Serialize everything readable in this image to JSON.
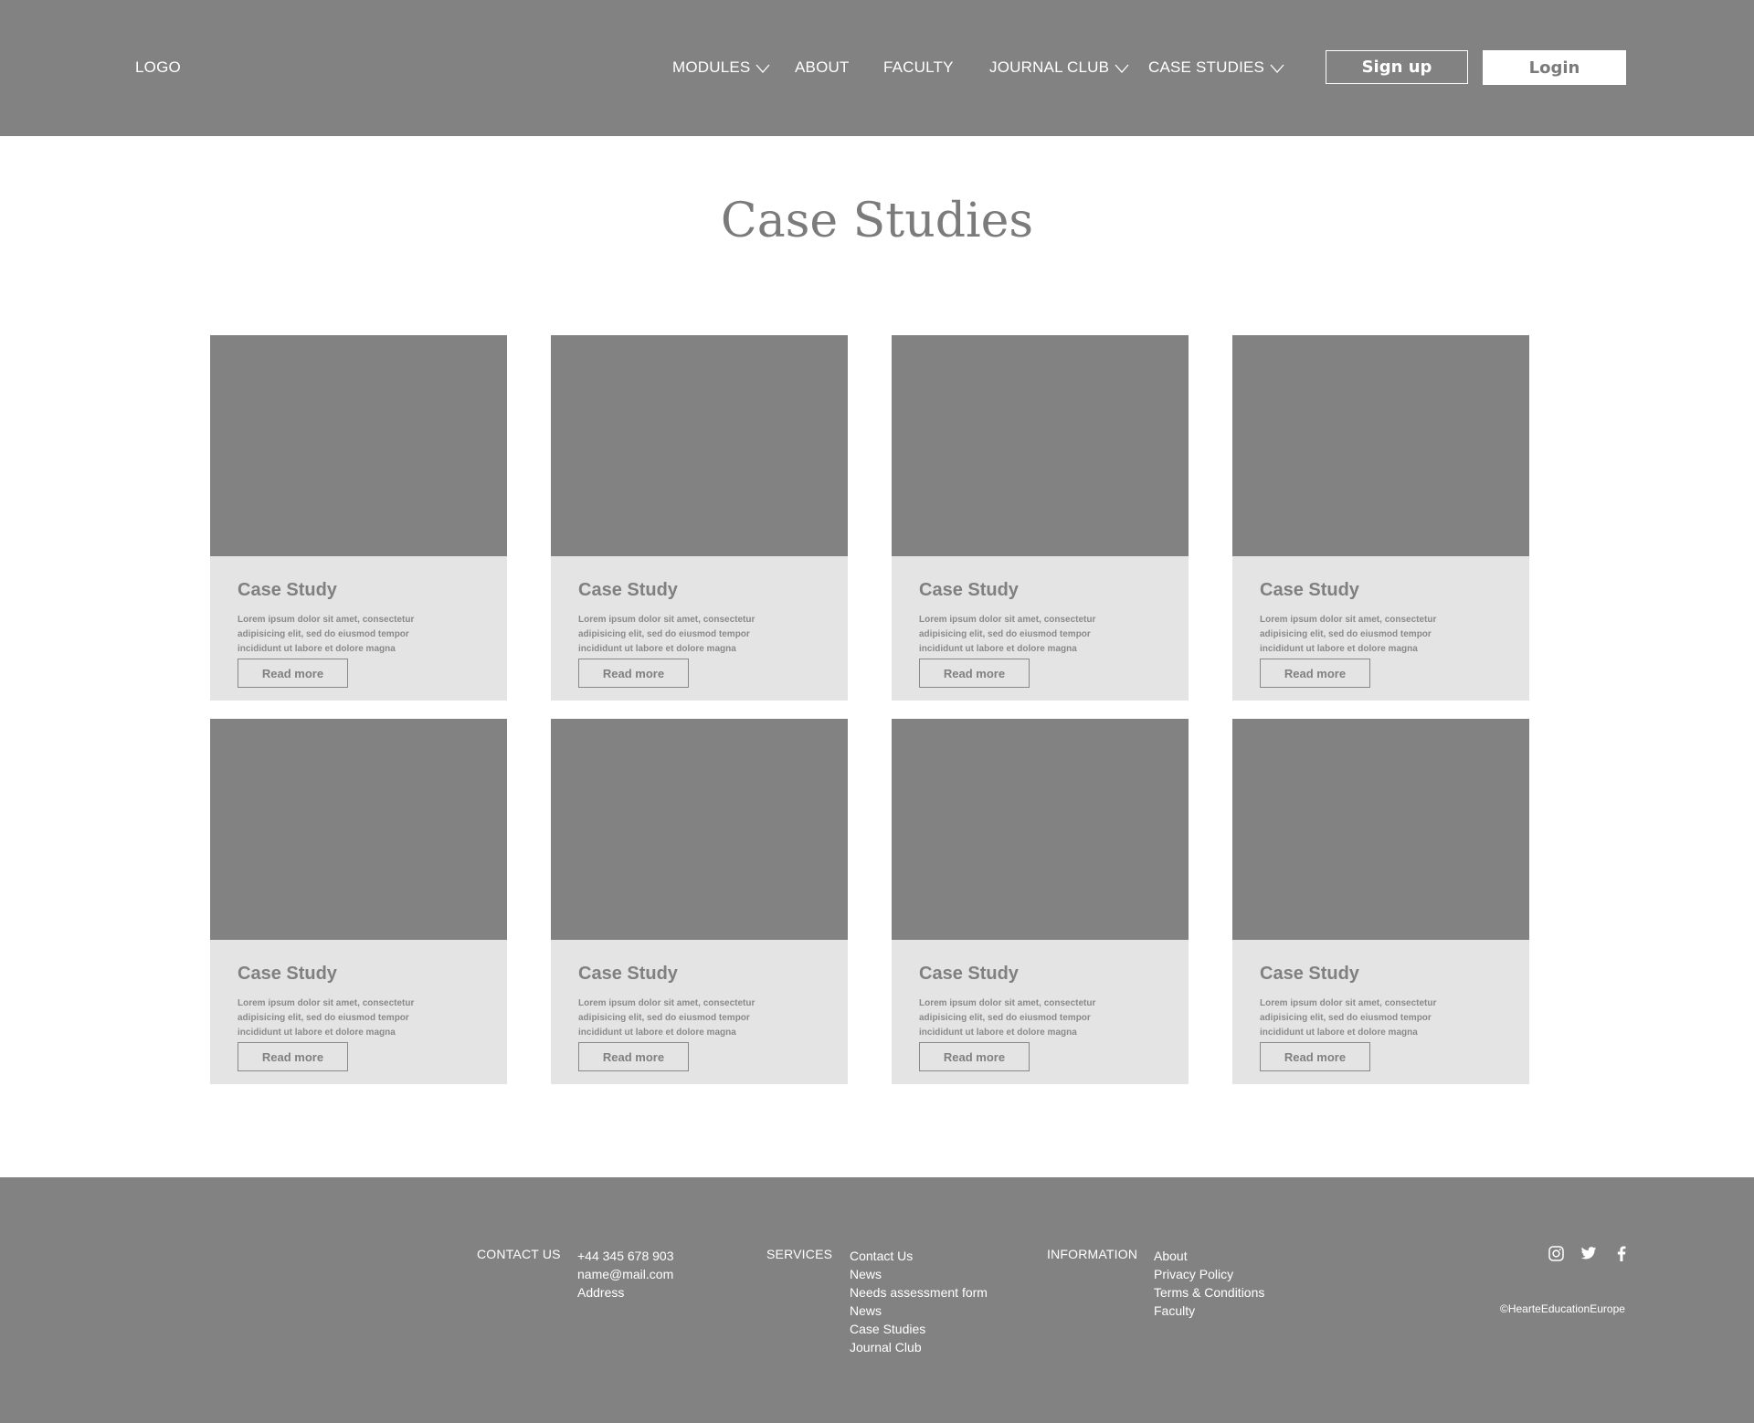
{
  "header": {
    "logo": "LOGO",
    "nav": [
      {
        "label": "MODULES",
        "dropdown": true
      },
      {
        "label": "ABOUT",
        "dropdown": false
      },
      {
        "label": "FACULTY",
        "dropdown": false
      },
      {
        "label": "JOURNAL CLUB",
        "dropdown": true
      },
      {
        "label": "CASE STUDIES",
        "dropdown": true
      }
    ],
    "signup_label": "Sign up",
    "login_label": "Login"
  },
  "main": {
    "title": "Case Studies",
    "cards": [
      {
        "title": "Case Study",
        "text": "Lorem ipsum dolor sit amet, consectetur adipisicing elit, sed do eiusmod tempor incididunt ut labore et dolore magna",
        "button": "Read more"
      },
      {
        "title": "Case Study",
        "text": "Lorem ipsum dolor sit amet, consectetur adipisicing elit, sed do eiusmod tempor incididunt ut labore et dolore magna",
        "button": "Read more"
      },
      {
        "title": "Case Study",
        "text": "Lorem ipsum dolor sit amet, consectetur adipisicing elit, sed do eiusmod tempor incididunt ut labore et dolore magna",
        "button": "Read more"
      },
      {
        "title": "Case Study",
        "text": "Lorem ipsum dolor sit amet, consectetur adipisicing elit, sed do eiusmod tempor incididunt ut labore et dolore magna",
        "button": "Read more"
      },
      {
        "title": "Case Study",
        "text": "Lorem ipsum dolor sit amet, consectetur adipisicing elit, sed do eiusmod tempor incididunt ut labore et dolore magna",
        "button": "Read more"
      },
      {
        "title": "Case Study",
        "text": "Lorem ipsum dolor sit amet, consectetur adipisicing elit, sed do eiusmod tempor incididunt ut labore et dolore magna",
        "button": "Read more"
      },
      {
        "title": "Case Study",
        "text": "Lorem ipsum dolor sit amet, consectetur adipisicing elit, sed do eiusmod tempor incididunt ut labore et dolore magna",
        "button": "Read more"
      },
      {
        "title": "Case Study",
        "text": "Lorem ipsum dolor sit amet, consectetur adipisicing elit, sed do eiusmod tempor incididunt ut labore et dolore magna",
        "button": "Read more"
      }
    ]
  },
  "footer": {
    "contact_heading": "CONTACT US",
    "contact_items": [
      "+44 345 678 903",
      "name@mail.com",
      "Address"
    ],
    "services_heading": "SERVICES",
    "services_items": [
      "Contact Us",
      "News",
      "Needs assessment form",
      "News",
      "Case Studies",
      "Journal Club"
    ],
    "information_heading": "INFORMATION",
    "information_items": [
      "About",
      "Privacy Policy",
      "Terms & Conditions",
      "Faculty"
    ],
    "social": [
      "instagram-icon",
      "twitter-icon",
      "facebook-icon"
    ],
    "copyright": "©HearteEducationEurope"
  },
  "colors": {
    "header_bg": "#828282",
    "card_bg": "#e4e4e4",
    "image_placeholder": "#828282",
    "text_gray": "#7b7b7b"
  }
}
